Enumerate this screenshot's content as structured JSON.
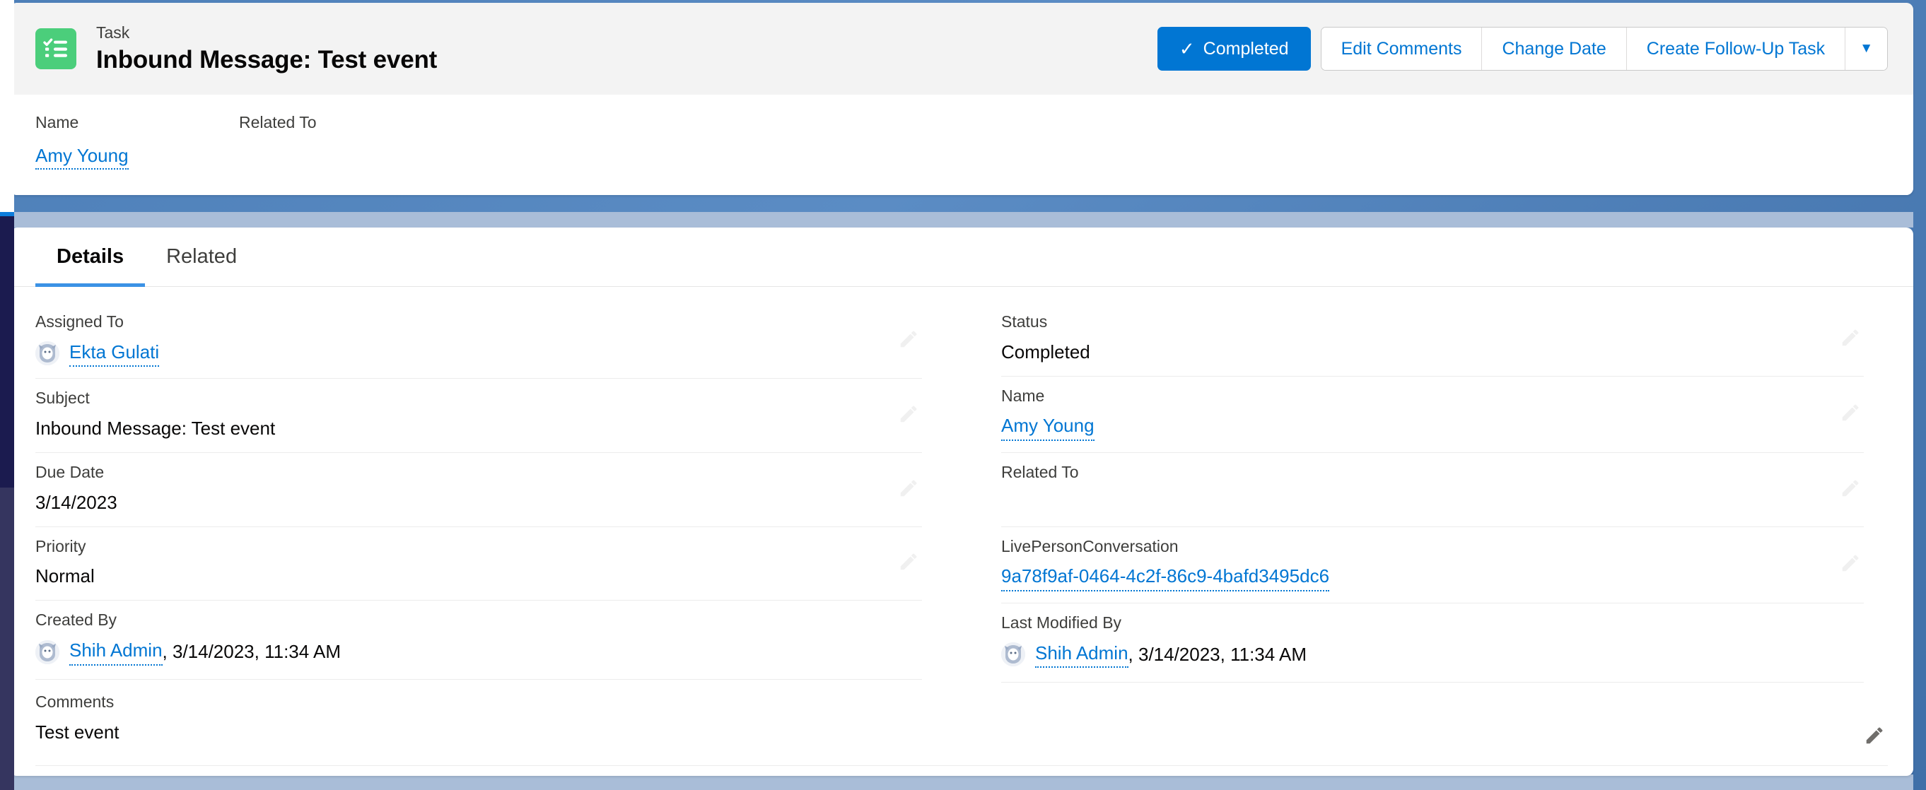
{
  "header": {
    "object_type": "Task",
    "record_title": "Inbound Message: Test event",
    "icon": "task-checklist-icon",
    "icon_color": "#4bce7b",
    "actions": {
      "primary_label": "Completed",
      "primary_color": "#0176d3",
      "primary_icon": "check-icon",
      "items": [
        {
          "label": "Edit Comments",
          "name": "edit-comments-button"
        },
        {
          "label": "Change Date",
          "name": "change-date-button"
        },
        {
          "label": "Create Follow-Up Task",
          "name": "create-follow-up-task-button"
        }
      ],
      "more_icon": "chevron-down-icon"
    },
    "compact_fields": [
      {
        "label": "Name",
        "value": "Amy Young",
        "is_link": true
      },
      {
        "label": "Related To",
        "value": "",
        "is_link": false
      }
    ]
  },
  "tabs": [
    {
      "label": "Details",
      "active": true
    },
    {
      "label": "Related",
      "active": false
    }
  ],
  "details": {
    "left_column": [
      {
        "label": "Assigned To",
        "value": "Ekta Gulati",
        "is_link": true,
        "has_avatar": true,
        "editable": true,
        "pencil_state": "faint"
      },
      {
        "label": "Subject",
        "value": "Inbound Message: Test event",
        "is_link": false,
        "has_avatar": false,
        "editable": true,
        "pencil_state": "faint"
      },
      {
        "label": "Due Date",
        "value": "3/14/2023",
        "is_link": false,
        "has_avatar": false,
        "editable": true,
        "pencil_state": "faint"
      },
      {
        "label": "Priority",
        "value": "Normal",
        "is_link": false,
        "has_avatar": false,
        "editable": true,
        "pencil_state": "faint"
      },
      {
        "label": "Created By",
        "value": "Shih Admin",
        "suffix": ", 3/14/2023, 11:34 AM",
        "is_link": true,
        "has_avatar": true,
        "editable": false,
        "pencil_state": "none"
      }
    ],
    "right_column": [
      {
        "label": "Status",
        "value": "Completed",
        "is_link": false,
        "has_avatar": false,
        "editable": true,
        "pencil_state": "faint"
      },
      {
        "label": "Name",
        "value": "Amy Young",
        "is_link": true,
        "has_avatar": false,
        "editable": true,
        "pencil_state": "faint"
      },
      {
        "label": "Related To",
        "value": "",
        "is_link": false,
        "has_avatar": false,
        "editable": true,
        "pencil_state": "faint"
      },
      {
        "label": "LivePersonConversation",
        "value": "9a78f9af-0464-4c2f-86c9-4bafd3495dc6",
        "is_link": true,
        "has_avatar": false,
        "editable": true,
        "pencil_state": "faint"
      },
      {
        "label": "Last Modified By",
        "value": "Shih Admin",
        "suffix": ", 3/14/2023, 11:34 AM",
        "is_link": true,
        "has_avatar": true,
        "editable": false,
        "pencil_state": "none"
      }
    ],
    "comments": {
      "label": "Comments",
      "value": "Test event",
      "editable": true,
      "pencil_state": "dark"
    }
  },
  "colors": {
    "link": "#0176d3",
    "brand": "#0176d3",
    "nav_rail": "#1b1b4f",
    "page_background": "#a9bdd8"
  }
}
